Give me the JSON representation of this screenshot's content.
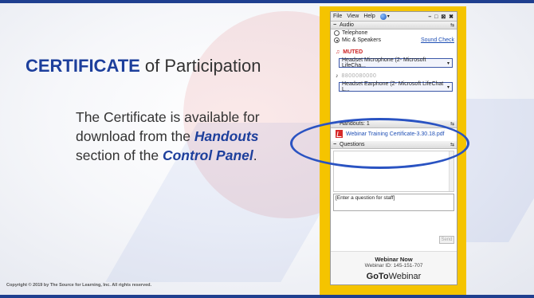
{
  "slide": {
    "title_strong": "CERTIFICATE",
    "title_rest": " of Participation",
    "body_before": "The Certificate is available for download from the ",
    "handouts_label": "Handouts",
    "body_middle": " section of the ",
    "control_panel_label": "Control Panel",
    "body_after": ".",
    "copyright": "Copyright © 2019 by The Source for Learning, Inc. All rights reserved."
  },
  "control_panel": {
    "menu": {
      "file": "File",
      "view": "View",
      "help": "Help",
      "globe_caret": "▾",
      "window_buttons": "–  □  ⊠  ✖"
    },
    "pin_glyph": "⇆",
    "audio": {
      "header": "Audio",
      "toggle": "−",
      "telephone": "Telephone",
      "mic_speakers": "Mic & Speakers",
      "selected": "Mic & Speakers",
      "sound_check": "Sound Check",
      "mic_status": "MUTED",
      "mic_device": "Headset Microphone (2- Microsoft LifeCha...",
      "speaker_level_glyphs": "8800080000",
      "speaker_device": "Headset Earphone (2- Microsoft LifeChat L...",
      "dropdown_caret": "▾"
    },
    "handouts": {
      "header": "Handouts: 1",
      "toggle": "−",
      "items": [
        {
          "name": "Webinar Training Certificate-3.30.18.pdf",
          "type": "pdf"
        }
      ]
    },
    "questions": {
      "header": "Questions",
      "toggle": "−",
      "input_placeholder": "[Enter a question for staff]",
      "send_label": "Send"
    },
    "footer": {
      "title": "Webinar Now",
      "webinar_id": "Webinar ID: 145-151-707",
      "brand_goto": "GoTo",
      "brand_webinar": "Webinar"
    }
  },
  "colors": {
    "accent_blue": "#1d3f9c",
    "frame_yellow": "#f5c400",
    "muted_red": "#cc2222",
    "link_blue": "#1f4fb5"
  },
  "icons": {
    "menu_globe": "globe-icon",
    "mic": "microphone-icon",
    "speaker": "speaker-icon",
    "handout_file": "pdf-icon",
    "highlight": "ellipse-highlight-annotation"
  }
}
